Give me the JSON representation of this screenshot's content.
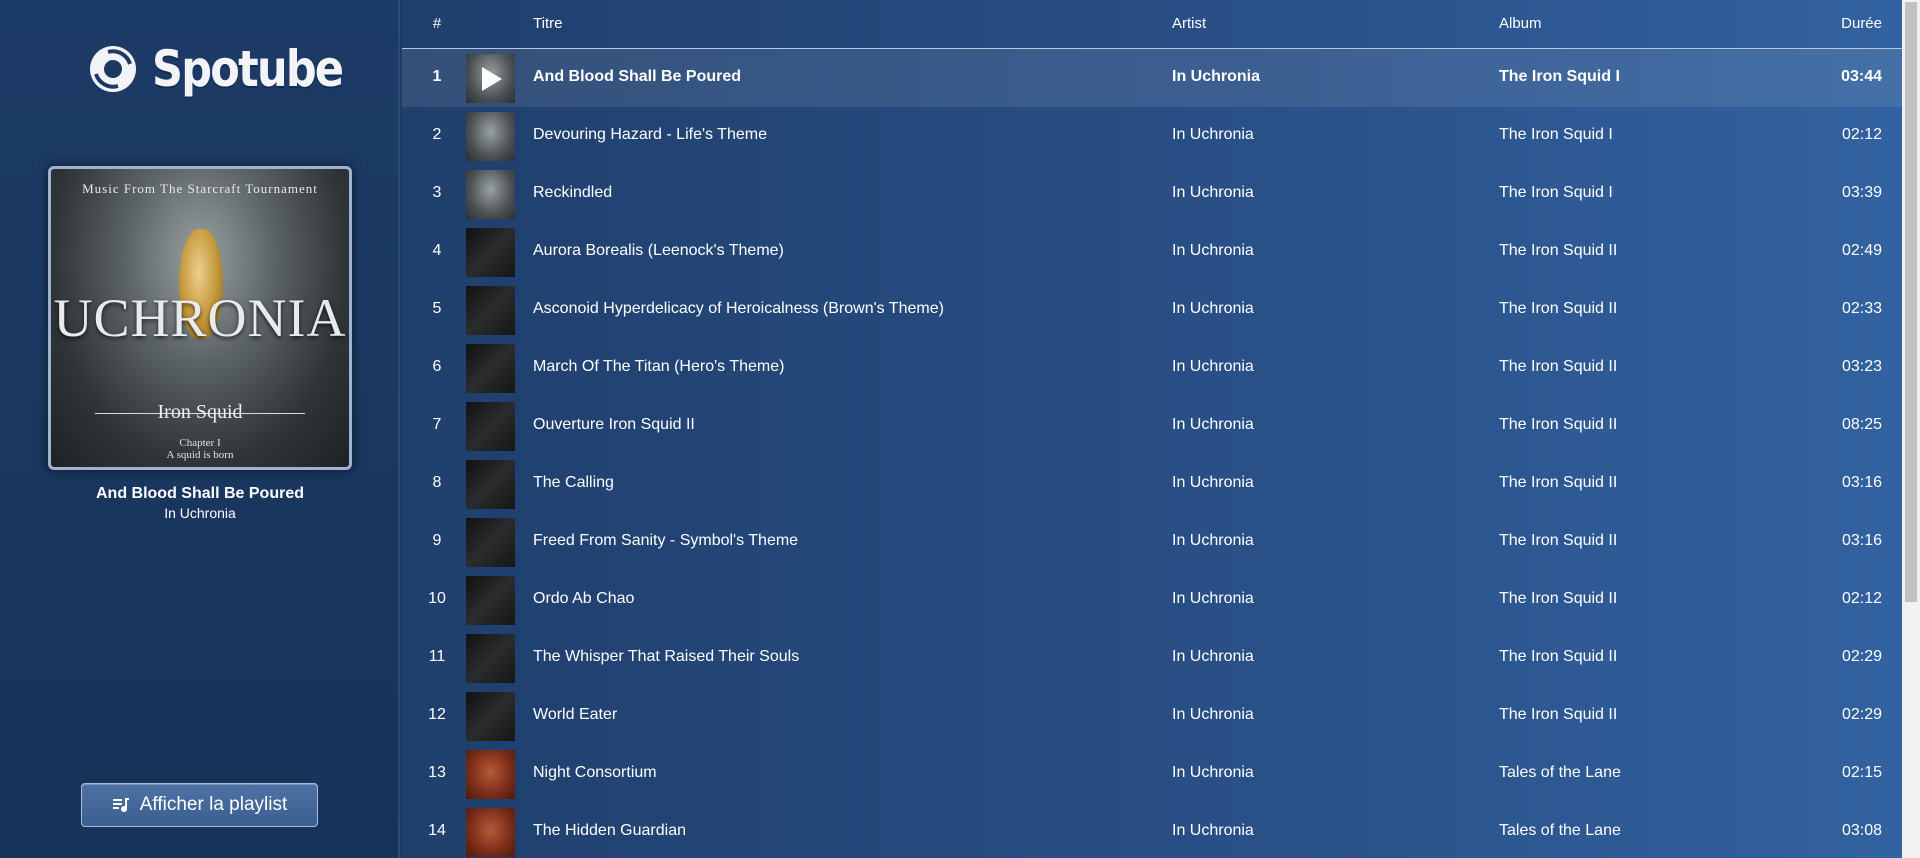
{
  "app": {
    "name": "Spotube"
  },
  "now_playing": {
    "title": "And Blood Shall Be Poured",
    "artist": "In Uchronia",
    "cover": {
      "top_text": "Music From The Starcraft Tournament",
      "main_text": "UCHRONIA",
      "subtitle": "Iron Squid",
      "chapter": "Chapter I",
      "tagline": "A squid is born"
    }
  },
  "sidebar": {
    "playlist_button_label": "Afficher la playlist"
  },
  "table": {
    "headers": {
      "num": "#",
      "title": "Titre",
      "artist": "Artist",
      "album": "Album",
      "duration": "Durée"
    },
    "rows": [
      {
        "num": "1",
        "title": "And Blood Shall Be Poured",
        "artist": "In Uchronia",
        "album": "The Iron Squid I",
        "duration": "03:44"
      },
      {
        "num": "2",
        "title": "Devouring Hazard - Life's Theme",
        "artist": "In Uchronia",
        "album": "The Iron Squid I",
        "duration": "02:12"
      },
      {
        "num": "3",
        "title": "Reckindled",
        "artist": "In Uchronia",
        "album": "The Iron Squid I",
        "duration": "03:39"
      },
      {
        "num": "4",
        "title": "Aurora Borealis (Leenock's Theme)",
        "artist": "In Uchronia",
        "album": "The Iron Squid II",
        "duration": "02:49"
      },
      {
        "num": "5",
        "title": "Asconoid Hyperdelicacy of Heroicalness (Brown's Theme)",
        "artist": "In Uchronia",
        "album": "The Iron Squid II",
        "duration": "02:33"
      },
      {
        "num": "6",
        "title": "March Of The Titan (Hero's Theme)",
        "artist": "In Uchronia",
        "album": "The Iron Squid II",
        "duration": "03:23"
      },
      {
        "num": "7",
        "title": "Ouverture Iron Squid II",
        "artist": "In Uchronia",
        "album": "The Iron Squid II",
        "duration": "08:25"
      },
      {
        "num": "8",
        "title": "The Calling",
        "artist": "In Uchronia",
        "album": "The Iron Squid II",
        "duration": "03:16"
      },
      {
        "num": "9",
        "title": "Freed From Sanity - Symbol's Theme",
        "artist": "In Uchronia",
        "album": "The Iron Squid II",
        "duration": "03:16"
      },
      {
        "num": "10",
        "title": "Ordo Ab Chao",
        "artist": "In Uchronia",
        "album": "The Iron Squid II",
        "duration": "02:12"
      },
      {
        "num": "11",
        "title": "The Whisper That Raised Their Souls",
        "artist": "In Uchronia",
        "album": "The Iron Squid II",
        "duration": "02:29"
      },
      {
        "num": "12",
        "title": "World Eater",
        "artist": "In Uchronia",
        "album": "The Iron Squid II",
        "duration": "02:29"
      },
      {
        "num": "13",
        "title": "Night Consortium",
        "artist": "In Uchronia",
        "album": "Tales of the Lane",
        "duration": "02:15"
      },
      {
        "num": "14",
        "title": "The Hidden Guardian",
        "artist": "In Uchronia",
        "album": "Tales of the Lane",
        "duration": "03:08"
      }
    ]
  }
}
